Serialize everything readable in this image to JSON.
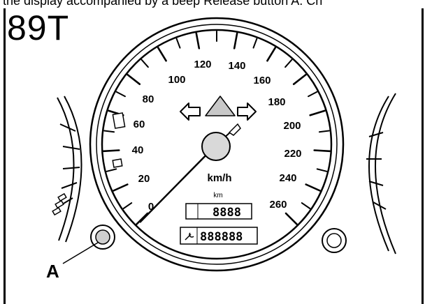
{
  "caption": "the display accompanied by a beep Release button A. Ch",
  "figure_code": "89T",
  "speedometer": {
    "scale_labels": [
      "0",
      "20",
      "40",
      "60",
      "80",
      "100",
      "120",
      "140",
      "160",
      "180",
      "200",
      "220",
      "240",
      "260"
    ],
    "unit_label": "km/h",
    "trip_unit_label": "km",
    "trip_display": "8888",
    "odometer_display": "888888"
  },
  "callout": {
    "label": "A"
  }
}
